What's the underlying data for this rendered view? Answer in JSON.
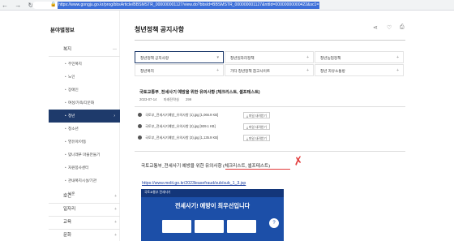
{
  "browser": {
    "url": "https://www.gongju.go.kr/prog/bbsArticle/BBSMSTR_000000001127/view.do?bbsId=BBSMSTR_000000001127&nttId=00000000000422&sc1=",
    "nav_arrows": "← → ↻ ⌂",
    "lock_icon": "🔒"
  },
  "sidebar": {
    "title": "분야별정보",
    "sections": [
      {
        "label": "복지",
        "caret": "—"
      },
      {
        "label": "보건",
        "caret": "+"
      },
      {
        "label": "일자리",
        "caret": "+"
      },
      {
        "label": "교육",
        "caret": "+"
      },
      {
        "label": "문화",
        "caret": "+"
      }
    ],
    "sub_items": [
      {
        "label": "주민복지"
      },
      {
        "label": "노인"
      },
      {
        "label": "장애인"
      },
      {
        "label": "여성/가족/다문화"
      },
      {
        "label": "청년",
        "arrow": "›"
      },
      {
        "label": "청소년"
      },
      {
        "label": "영유아/아동"
      },
      {
        "label": "맞나래푸 마을만들기"
      },
      {
        "label": "자원봉사센터"
      },
      {
        "label": "관내복지시설/기관"
      },
      {
        "label": "보훈"
      }
    ]
  },
  "main": {
    "title": "청년정책 공지사항",
    "icons": {
      "share": "share-icon",
      "favorite": "heart-icon",
      "print": "print-icon"
    },
    "categories": [
      {
        "label": "청년정책 공지사항",
        "marker": "▾"
      },
      {
        "label": "청년일자리정책",
        "marker": "+"
      },
      {
        "label": "청년농업정책",
        "marker": "+"
      },
      {
        "label": "청년복지",
        "marker": "+"
      },
      {
        "label": "기타 청년정책 참고사이트",
        "marker": "+"
      },
      {
        "label": "청년 자유소통방",
        "marker": "+"
      }
    ],
    "post": {
      "title": "국토교통부_전세사기 예방을 위한 유의사항 (체크리스트, 셀프테스트)",
      "date": "2023-07-14",
      "author": "미래전략실",
      "views": "299"
    },
    "files": [
      {
        "name": "국토부_전세사기예방_유의사항 (1).jpg [1,066.9 KB]",
        "button": "파일 내려받기"
      },
      {
        "name": "국토부_전세사기예방_유의사항 (2).jpg [939.1 KB]",
        "button": "파일 내려받기"
      },
      {
        "name": "국토부_전세사기예방_유의사항 (3).jpg [1,135.9 KB]",
        "button": "파일 내려받기"
      }
    ],
    "body": {
      "title": "국토교통부_전세사기 예방을 위한 유의사항 (체크리스트, 셀프테스트)",
      "mark": "✗",
      "link": "https://www.molit.go.kr/2023leasefraud/sub/sub_1_3.jsp"
    },
    "poster": {
      "logo": "국토교통부  전세사기",
      "top_right": "",
      "headline": "전세사기! 예방이 최우선입니다",
      "sub": "",
      "cards": [
        "",
        "",
        "",
        ""
      ],
      "chat": "?"
    }
  }
}
